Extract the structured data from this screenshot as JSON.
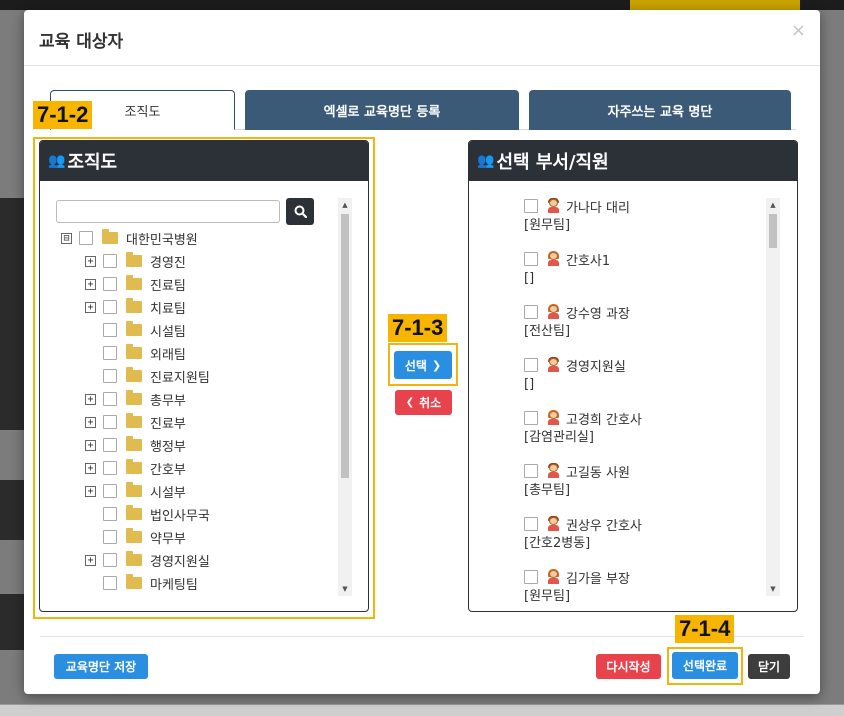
{
  "modal": {
    "title": "교육 대상자",
    "close": "×"
  },
  "tabs": [
    "조직도",
    "엑셀로 교육명단 등록",
    "자주쓰는 교육 명단"
  ],
  "labels": {
    "org": "7-1-2",
    "select": "7-1-3",
    "complete": "7-1-4"
  },
  "org_panel": {
    "title": "조직도",
    "search_placeholder": "",
    "tree": [
      {
        "label": "대한민국병원",
        "exp": "⊟",
        "level": 0
      },
      {
        "label": "경영진",
        "exp": "+",
        "level": 1
      },
      {
        "label": "진료팀",
        "exp": "+",
        "level": 1
      },
      {
        "label": "치료팀",
        "exp": "+",
        "level": 1
      },
      {
        "label": "시설팀",
        "exp": "",
        "level": 1
      },
      {
        "label": "외래팀",
        "exp": "",
        "level": 1
      },
      {
        "label": "진료지원팀",
        "exp": "",
        "level": 1
      },
      {
        "label": "총무부",
        "exp": "+",
        "level": 1
      },
      {
        "label": "진료부",
        "exp": "+",
        "level": 1
      },
      {
        "label": "행정부",
        "exp": "+",
        "level": 1
      },
      {
        "label": "간호부",
        "exp": "+",
        "level": 1
      },
      {
        "label": "시설부",
        "exp": "+",
        "level": 1
      },
      {
        "label": "법인사무국",
        "exp": "",
        "level": 1
      },
      {
        "label": "약무부",
        "exp": "",
        "level": 1
      },
      {
        "label": "경영지원실",
        "exp": "+",
        "level": 1
      },
      {
        "label": "마케팅팀",
        "exp": "",
        "level": 1
      }
    ]
  },
  "buttons": {
    "select": "선택",
    "cancel": "취소",
    "save_list": "교육명단 저장",
    "rewrite": "다시작성",
    "complete": "선택완료",
    "close": "닫기"
  },
  "sel_panel": {
    "title": "선택 부서/직원",
    "items": [
      {
        "name": "가나다 대리",
        "dept": "[원무팀]",
        "gender": "m"
      },
      {
        "name": "간호사1",
        "dept": "[]",
        "gender": "f"
      },
      {
        "name": "강수영 과장",
        "dept": "[전산팀]",
        "gender": "f"
      },
      {
        "name": "경영지원실",
        "dept": "[]",
        "gender": "m"
      },
      {
        "name": "고경희 간호사",
        "dept": "[감염관리실]",
        "gender": "f"
      },
      {
        "name": "고길동 사원",
        "dept": "[총무팀]",
        "gender": "m"
      },
      {
        "name": "권상우 간호사",
        "dept": "[간호2병동]",
        "gender": "m"
      },
      {
        "name": "김가을 부장",
        "dept": "[원무팀]",
        "gender": "f"
      }
    ]
  }
}
